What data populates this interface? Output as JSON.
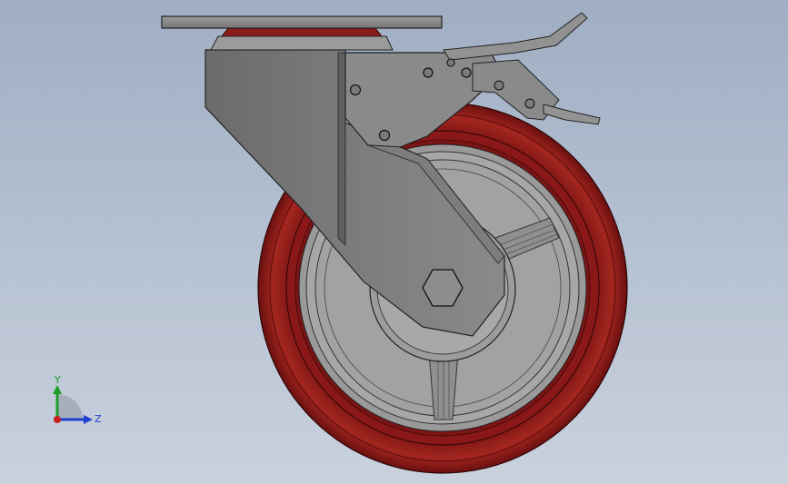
{
  "viewport": {
    "background_top": "#a0aec3",
    "background_bottom": "#c9d1dd"
  },
  "model": {
    "tire_color": "#8b1a1a",
    "tire_highlight": "#a82a26",
    "metal_color": "#8c8c8c",
    "metal_dark": "#6f6f6f",
    "hub_color": "#a9a9a9"
  },
  "triad": {
    "y_label": "Y",
    "z_label": "Z",
    "y_color": "#1f9e2a",
    "z_color": "#1f3fd0",
    "x_color": "#c81e1e"
  }
}
